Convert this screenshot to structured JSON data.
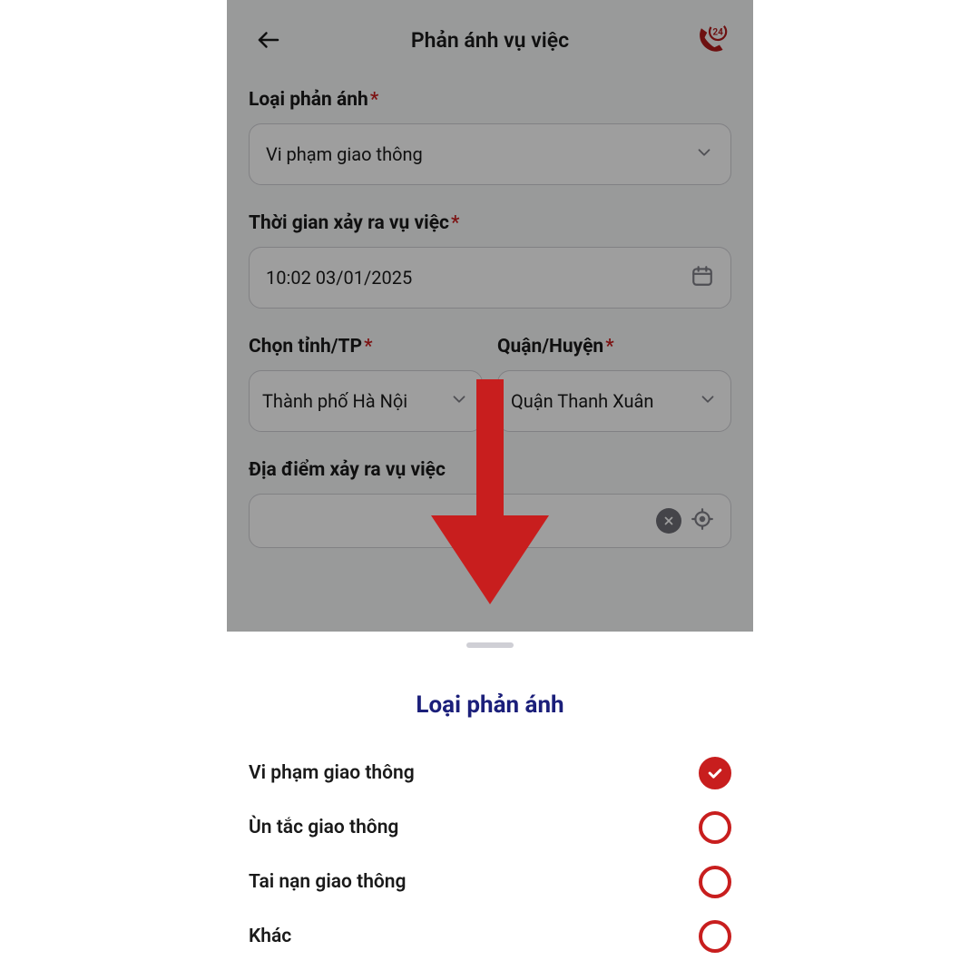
{
  "header": {
    "title": "Phản ánh vụ việc"
  },
  "form": {
    "type_label": "Loại phản ánh",
    "type_value": "Vi phạm giao thông",
    "time_label": "Thời gian xảy ra vụ việc",
    "time_value": "10:02 03/01/2025",
    "province_label": "Chọn tỉnh/TP",
    "province_value": "Thành phố Hà Nội",
    "district_label": "Quận/Huyện",
    "district_value": "Quận Thanh Xuân",
    "location_label": "Địa điểm xảy ra vụ việc"
  },
  "sheet": {
    "title": "Loại phản ánh",
    "options": [
      {
        "label": "Vi phạm giao thông",
        "selected": true
      },
      {
        "label": "Ùn tắc giao thông",
        "selected": false
      },
      {
        "label": "Tai nạn giao thông",
        "selected": false
      },
      {
        "label": "Khác",
        "selected": false
      }
    ]
  }
}
